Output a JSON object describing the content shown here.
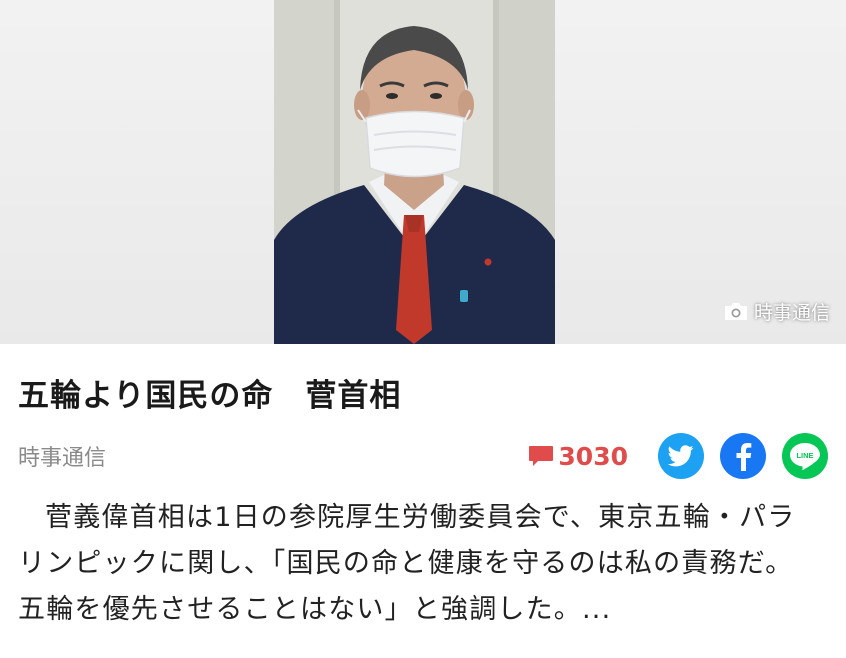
{
  "photo": {
    "credit": "時事通信",
    "credit_icon": "camera-icon",
    "colors": {
      "background": "#ececec",
      "suit": "#1f2a4a",
      "tie": "#c0392b",
      "mask": "#f4f5f7"
    }
  },
  "article": {
    "headline": "五輪より国民の命　菅首相",
    "source": "時事通信",
    "comment_count": "3030",
    "body": "菅義偉首相は1日の参院厚生労働委員会で、東京五輪・パラリンピックに関し、「国民の命と健康を守るのは私の責務だ。五輪を優先させることはない」と強調した。..."
  },
  "share": {
    "twitter_icon": "twitter-icon",
    "facebook_icon": "facebook-icon",
    "line_icon": "line-icon",
    "line_text": "LINE"
  },
  "colors": {
    "comment": "#e04b4b",
    "twitter": "#1da1f2",
    "facebook": "#1877f2",
    "line": "#06c755",
    "source_text": "#8a8a8a"
  }
}
